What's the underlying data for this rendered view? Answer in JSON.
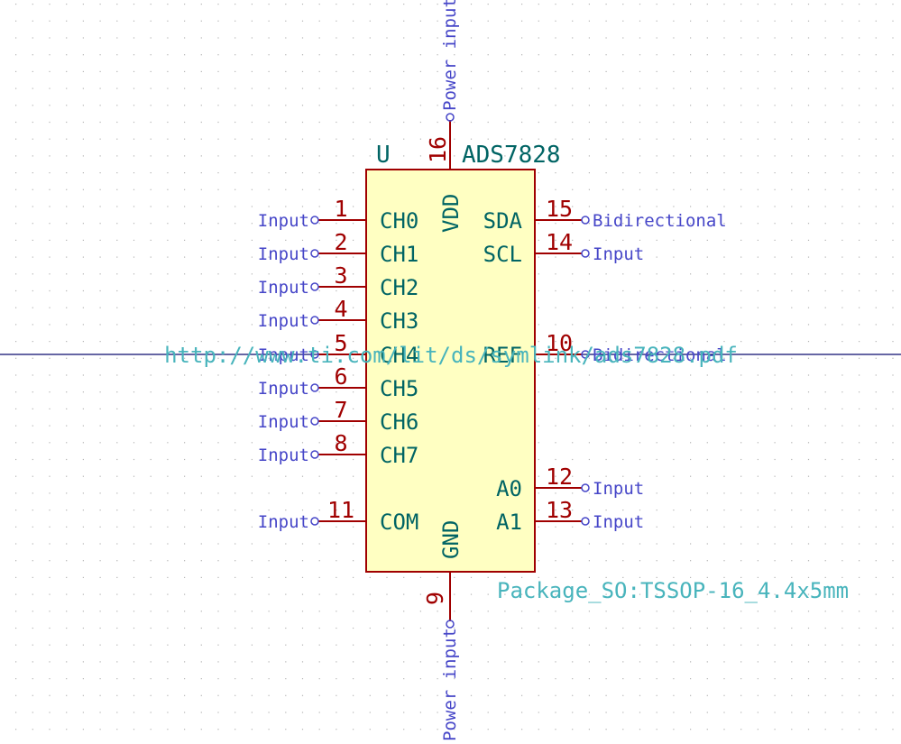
{
  "symbol": {
    "reference": "U",
    "value": "ADS7828",
    "footprint": "Package_SO:TSSOP-16_4.4x5mm",
    "datasheet": "http://www.ti.com/lit/ds/symlink/ads7828.pdf"
  },
  "pins": {
    "p1": {
      "number": "1",
      "name": "CH0",
      "type": "Input"
    },
    "p2": {
      "number": "2",
      "name": "CH1",
      "type": "Input"
    },
    "p3": {
      "number": "3",
      "name": "CH2",
      "type": "Input"
    },
    "p4": {
      "number": "4",
      "name": "CH3",
      "type": "Input"
    },
    "p5": {
      "number": "5",
      "name": "CH4",
      "type": "Input"
    },
    "p6": {
      "number": "6",
      "name": "CH5",
      "type": "Input"
    },
    "p7": {
      "number": "7",
      "name": "CH6",
      "type": "Input"
    },
    "p8": {
      "number": "8",
      "name": "CH7",
      "type": "Input"
    },
    "p11": {
      "number": "11",
      "name": "COM",
      "type": "Input"
    },
    "p15": {
      "number": "15",
      "name": "SDA",
      "type": "Bidirectional"
    },
    "p14": {
      "number": "14",
      "name": "SCL",
      "type": "Input"
    },
    "p10": {
      "number": "10",
      "name": "REF",
      "type": "Bidirectional"
    },
    "p12": {
      "number": "12",
      "name": "A0",
      "type": "Input"
    },
    "p13": {
      "number": "13",
      "name": "A1",
      "type": "Input"
    },
    "p16": {
      "number": "16",
      "name": "VDD",
      "type": "Power input"
    },
    "p9": {
      "number": "9",
      "name": "GND",
      "type": "Power input"
    }
  },
  "colors": {
    "background": "#ffffff",
    "grid": "#b4b4b4",
    "body_fill": "#ffffc2",
    "body_stroke": "#a00000",
    "pin_line": "#a00000",
    "pin_number": "#a00000",
    "pin_name": "#006464",
    "electrical_type": "#4646c8",
    "field_text": "#48b4bc",
    "crosshair": "#0a0a6e"
  }
}
